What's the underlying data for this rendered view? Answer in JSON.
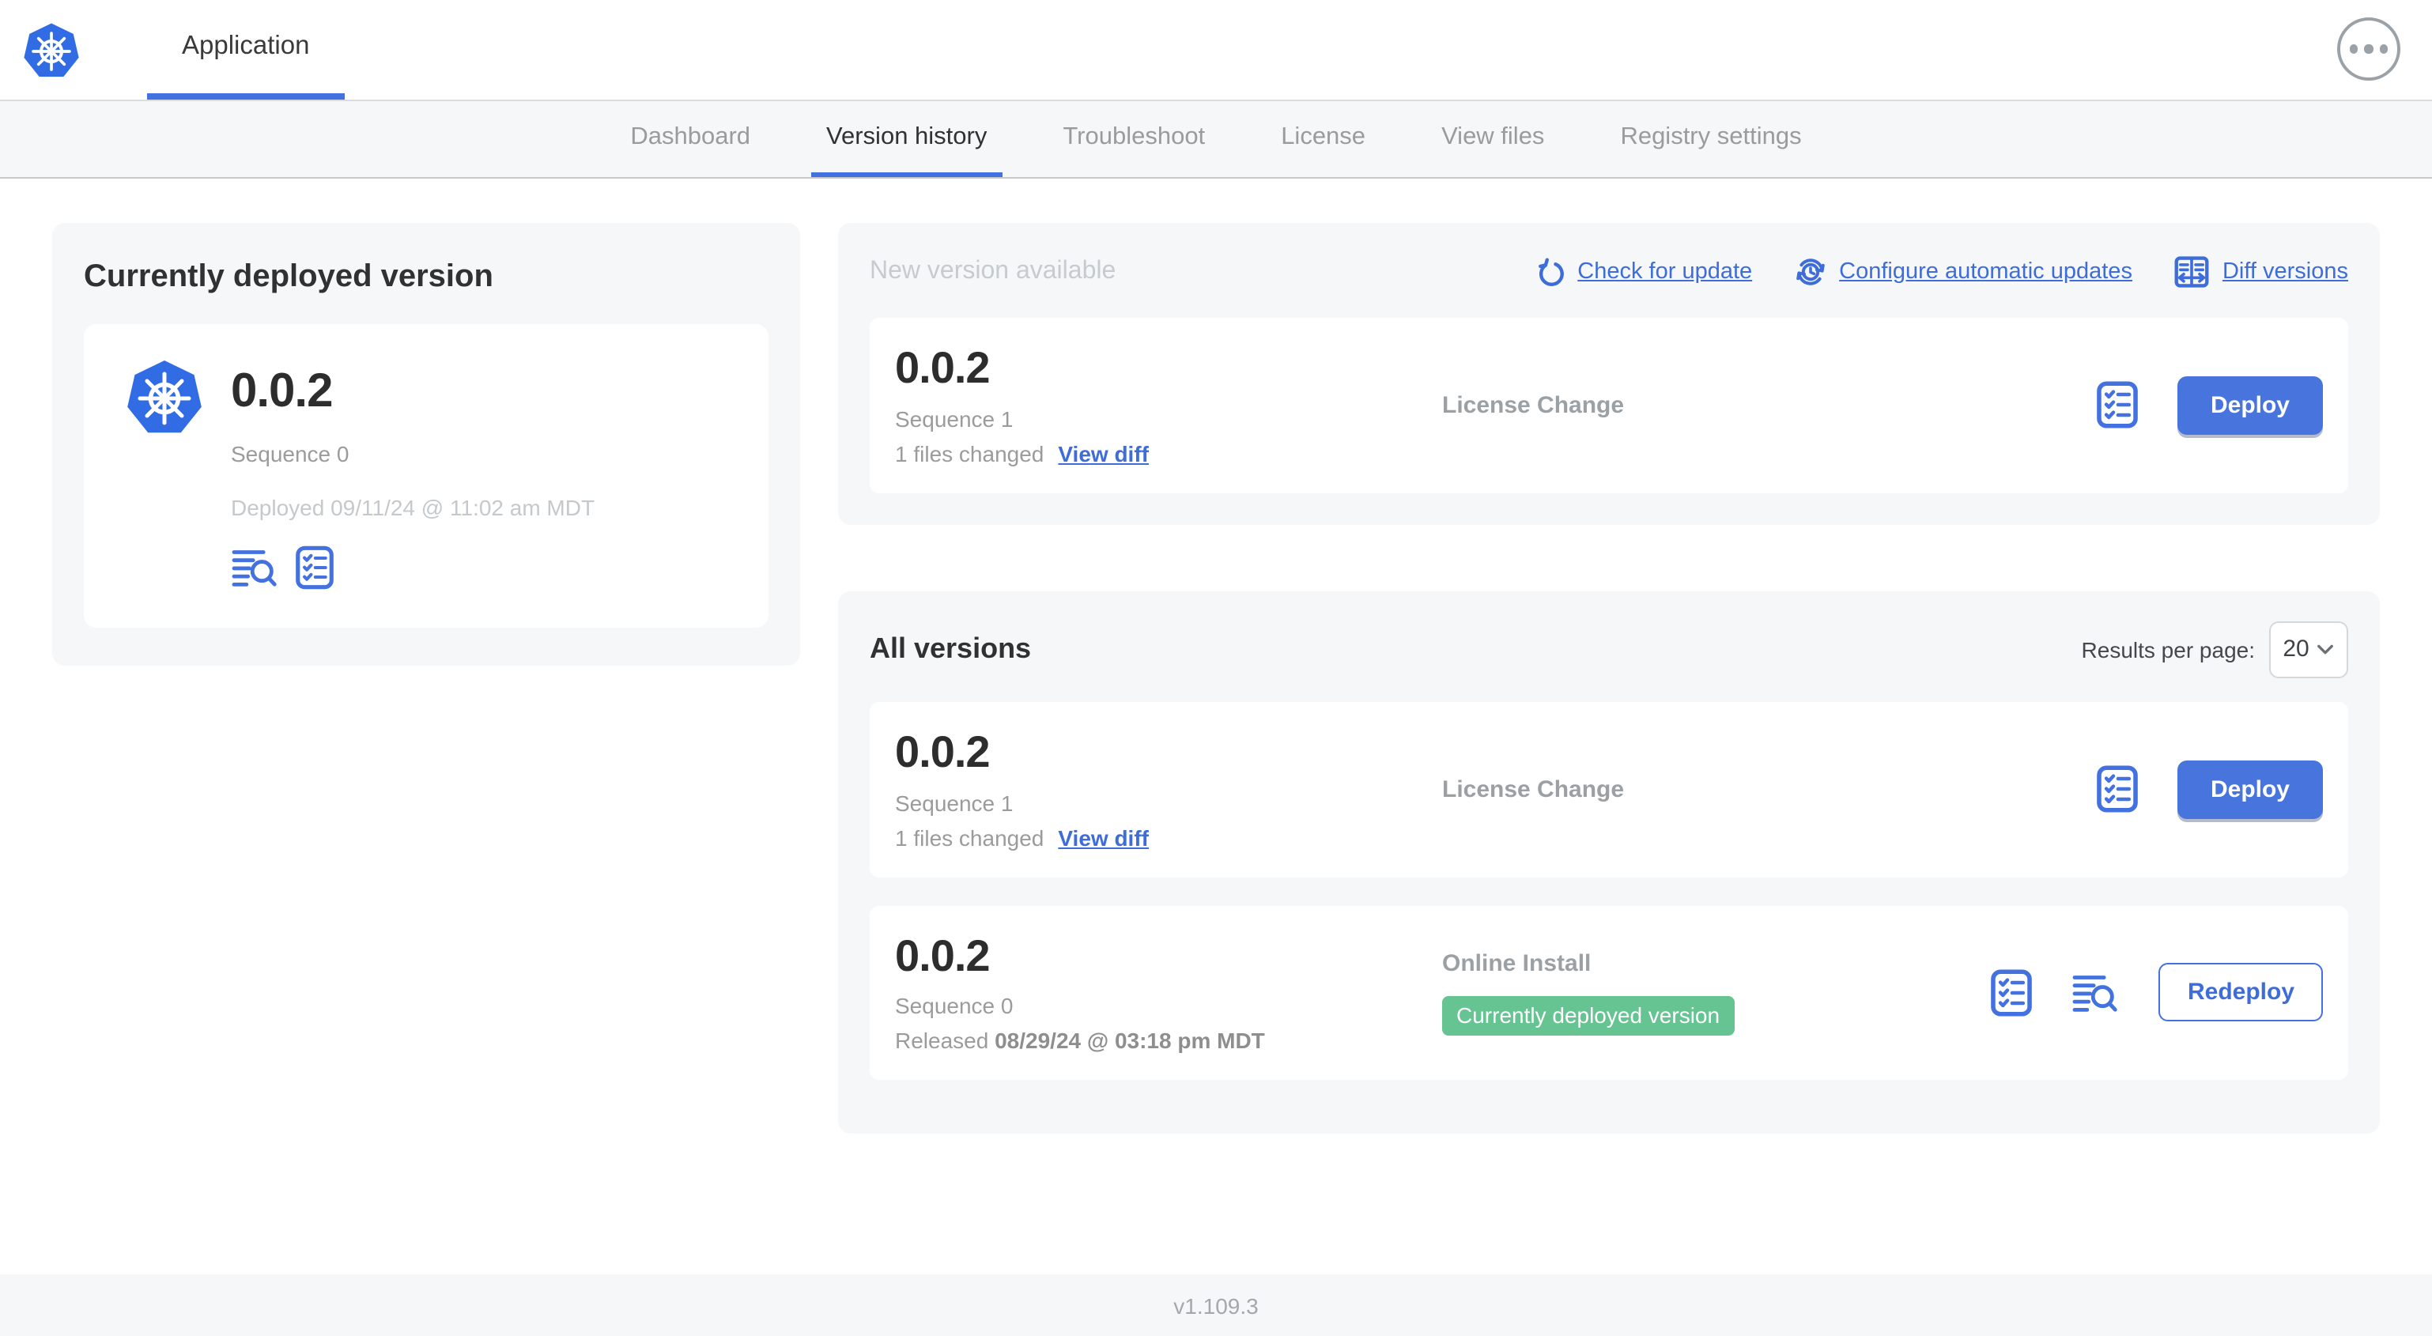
{
  "colors": {
    "accent_blue": "#3E6CD9",
    "button_blue": "#4874DD",
    "kubernetes_blue": "#326CE5",
    "badge_green": "#66C392",
    "panel_gray": "#F5F7F9"
  },
  "topbar": {
    "app_title": "Application"
  },
  "nav": {
    "tabs": [
      {
        "label": "Dashboard",
        "active": false
      },
      {
        "label": "Version history",
        "active": true
      },
      {
        "label": "Troubleshoot",
        "active": false
      },
      {
        "label": "License",
        "active": false
      },
      {
        "label": "View files",
        "active": false
      },
      {
        "label": "Registry settings",
        "active": false
      }
    ]
  },
  "current_version": {
    "title": "Currently deployed version",
    "version": "0.0.2",
    "sequence": "Sequence 0",
    "deployed": "Deployed 09/11/24 @ 11:02 am MDT"
  },
  "new_version": {
    "title": "New version available",
    "actions": {
      "check_for_update": "Check for update",
      "configure_automatic_updates": "Configure automatic updates",
      "diff_versions": "Diff versions"
    },
    "row": {
      "version": "0.0.2",
      "sequence": "Sequence 1",
      "files_changed": "1 files changed",
      "view_diff": "View diff",
      "source": "License Change",
      "deploy_label": "Deploy"
    }
  },
  "all_versions": {
    "title": "All versions",
    "results_per_page_label": "Results per page:",
    "results_per_page_value": "20",
    "rows": [
      {
        "version": "0.0.2",
        "sequence": "Sequence 1",
        "files_changed": "1 files changed",
        "view_diff": "View diff",
        "source": "License Change",
        "deploy_label": "Deploy"
      },
      {
        "version": "0.0.2",
        "sequence": "Sequence 0",
        "released_prefix": "Released",
        "released_date": "08/29/24 @ 03:18 pm MDT",
        "source": "Online Install",
        "badge": "Currently deployed version",
        "redeploy_label": "Redeploy"
      }
    ]
  },
  "footer": {
    "version": "v1.109.3"
  }
}
